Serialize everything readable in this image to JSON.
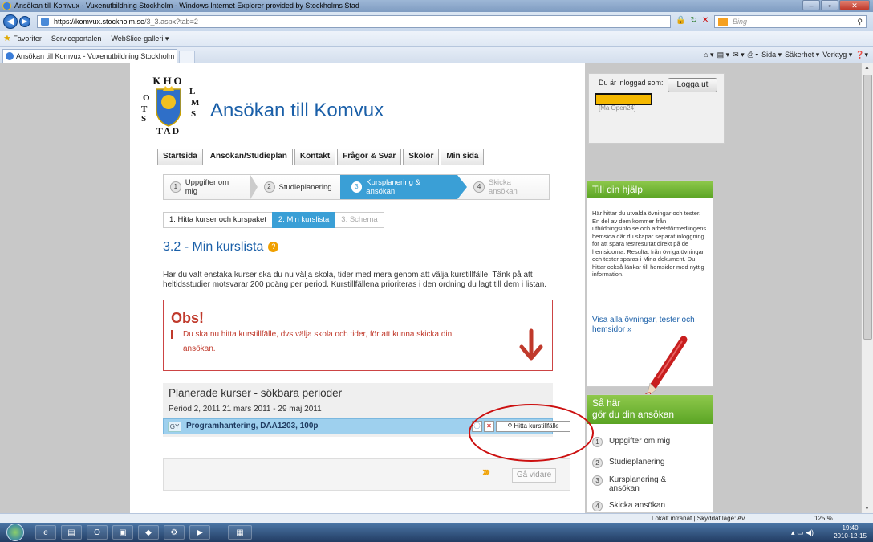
{
  "browser": {
    "title": "Ansökan till Komvux - Vuxenutbildning Stockholm - Windows Internet Explorer provided by Stockholms Stad",
    "url_host": "https://komvux.stockholm.se",
    "url_path": "/3_3.aspx?tab=2",
    "search_placeholder": "Bing",
    "favorites_label": "Favoriter",
    "fav_items": [
      "Serviceportalen",
      "WebSlice-galleri ▾"
    ],
    "tab_title": "Ansökan till Komvux - Vuxenutbildning Stockholm",
    "cmd_items": [
      "Sida ▾",
      "Säkerhet ▾",
      "Verktyg ▾"
    ],
    "status_zone": "Lokalt intranät | Skyddat läge: Av",
    "zoom": "125 %",
    "clock_time": "19:40",
    "clock_date": "2010-12-15"
  },
  "header": {
    "logo_text": "STOCKHOLMS STAD",
    "site_title": "Ansökan till Komvux"
  },
  "login": {
    "logged_in_label": "Du är inloggad som:",
    "logout_label": "Logga ut",
    "sub": "[Ma Open24]"
  },
  "nav": {
    "tabs": [
      "Startsida",
      "Ansökan/Studieplan",
      "Kontakt",
      "Frågor & Svar",
      "Skolor",
      "Min sida"
    ]
  },
  "steps": [
    {
      "num": "1",
      "label": "Uppgifter om mig"
    },
    {
      "num": "2",
      "label": "Studieplanering"
    },
    {
      "num": "3",
      "label": "Kursplanering & ansökan"
    },
    {
      "num": "4",
      "label": "Skicka ansökan"
    }
  ],
  "subtabs": [
    "1. Hitta kurser och kurspaket",
    "2. Min kurslista",
    "3. Schema"
  ],
  "main": {
    "heading": "3.2 - Min kurslista",
    "intro": "Har du valt enstaka kurser ska du nu välja skola, tider med mera genom att välja kurstillfälle. Tänk på att heltidsstudier motsvarar 200 poäng per period. Kurstillfällena prioriteras i den ordning du lagt till dem i listan.",
    "obs_title": "Obs!",
    "obs_text": "Du ska nu hitta kurstillfälle, dvs välja skola och tider, för att kunna skicka din ansökan."
  },
  "plan": {
    "title": "Planerade kurser - sökbara perioder",
    "period": "Period 2, 2011   21 mars 2011 - 29 maj 2011",
    "course_level": "GY",
    "course_name": "Programhantering, DAA1203, 100p",
    "find_label": "Hitta kurstillfälle"
  },
  "go": {
    "chevrons": "›››",
    "label": "Gå vidare"
  },
  "help": {
    "title": "Till din hjälp",
    "text": "Här hittar du utvalda övningar och tester. En del av dem kommer från utbildningsinfo.se och arbetsförmedlingens hemsida där du skapar separat inloggning för att spara testresultat direkt på de hemsidorna. Resultat från övriga övningar och tester sparas i Mina dokument. Du hittar också länkar till hemsidor med nyttig information.",
    "link": "Visa alla övningar, tester och hemsidor »"
  },
  "how": {
    "title_line1": "Så här",
    "title_line2": "gör du din ansökan",
    "items": [
      {
        "num": "1",
        "label": "Uppgifter om mig"
      },
      {
        "num": "2",
        "label": "Studieplanering"
      },
      {
        "num": "3",
        "label": "Kursplanering & ansökan"
      },
      {
        "num": "4",
        "label": "Skicka ansökan"
      }
    ]
  },
  "colors": {
    "accent_blue": "#3a9fd6",
    "title_blue": "#1a5fa8",
    "obs_red": "#c0392b",
    "help_green": "#5aa424"
  }
}
